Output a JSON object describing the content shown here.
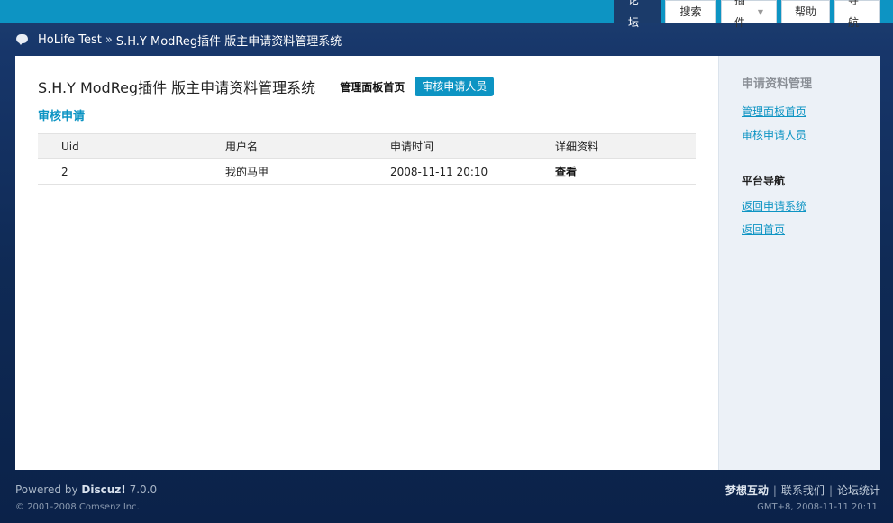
{
  "nav": {
    "tabs": [
      {
        "label": "论坛",
        "active": true
      },
      {
        "label": "搜索"
      },
      {
        "label": "插件"
      },
      {
        "label": "帮助"
      },
      {
        "label": "导航"
      }
    ]
  },
  "breadcrumb": {
    "site": "HoLife Test",
    "separator": "»",
    "current": "S.H.Y ModReg插件 版主申请资料管理系统"
  },
  "main": {
    "title": "S.H.Y ModReg插件 版主申请资料管理系统",
    "link_home": "管理面板首页",
    "btn_review": "审核申请人员",
    "section_title": "审核申请",
    "table": {
      "headers": [
        "Uid",
        "用户名",
        "申请时间",
        "详细资料"
      ],
      "rows": [
        {
          "uid": "2",
          "username": "我的马甲",
          "time": "2008-11-11 20:10",
          "detail": "查看"
        }
      ]
    }
  },
  "sidebar": {
    "section1_title": "申请资料管理",
    "section1_links": [
      "管理面板首页",
      "审核申请人员"
    ],
    "section2_title": "平台导航",
    "section2_links": [
      "返回申请系统",
      "返回首页"
    ]
  },
  "footer": {
    "powered_prefix": "Powered by",
    "brand": "Discuz!",
    "version": "7.0.0",
    "copyright": "© 2001-2008 Comsenz Inc.",
    "link1": "梦想互动",
    "link2": "联系我们",
    "link3": "论坛统计",
    "separator": "|",
    "time": "GMT+8, 2008-11-11 20:11."
  },
  "colors": {
    "accent": "#0d94c3",
    "background": "#17366a"
  }
}
